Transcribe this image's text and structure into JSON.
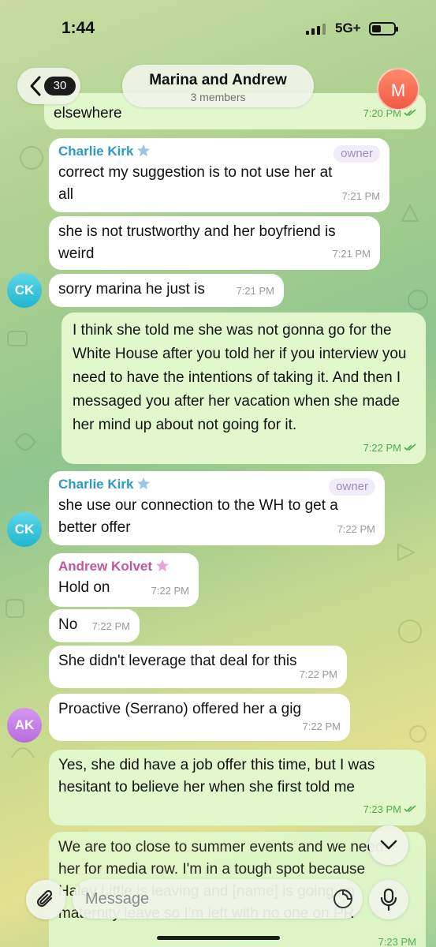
{
  "status_bar": {
    "time": "1:44",
    "network": "5G+"
  },
  "header": {
    "unread_count": "30",
    "title": "Marina and Andrew",
    "subtitle": "3 members",
    "avatar_initial": "M"
  },
  "messages": [
    {
      "id": "m0",
      "direction": "outgoing",
      "text": "elsewhere",
      "time": "7:20 PM"
    },
    {
      "id": "m1",
      "direction": "incoming",
      "sender": "Charlie Kirk",
      "badge": "owner",
      "text": "correct my suggestion is to not use her at all",
      "time": "7:21 PM"
    },
    {
      "id": "m2",
      "direction": "incoming",
      "text": "she is not trustworthy and her boyfriend is weird",
      "time": "7:21 PM"
    },
    {
      "id": "m3",
      "direction": "incoming",
      "text": "sorry marina he just is",
      "time": "7:21 PM",
      "avatar": "CK"
    },
    {
      "id": "m4",
      "direction": "outgoing",
      "text": "I think she told me she was not gonna go for the White House after you told her if you interview you need to have the intentions of taking it. And then I messaged you after her vacation when she made her mind up about not going for it.",
      "time": "7:22 PM"
    },
    {
      "id": "m5",
      "direction": "incoming",
      "sender": "Charlie Kirk",
      "badge": "owner",
      "text": "she use our connection to the WH to get a better offer",
      "time": "7:22 PM",
      "avatar": "CK"
    },
    {
      "id": "m6",
      "direction": "incoming",
      "sender": "Andrew Kolvet",
      "text": "Hold on",
      "time": "7:22 PM"
    },
    {
      "id": "m7",
      "direction": "incoming",
      "text": "No",
      "time": "7:22 PM"
    },
    {
      "id": "m8",
      "direction": "incoming",
      "text": "She didn't leverage that deal for this",
      "time": "7:22 PM"
    },
    {
      "id": "m9",
      "direction": "incoming",
      "text": "Proactive (Serrano) offered her a gig",
      "time": "7:22 PM",
      "avatar": "AK"
    },
    {
      "id": "m10",
      "direction": "outgoing",
      "text": "Yes, she did have a job offer this time, but I was hesitant to believe her when she first told me",
      "time": "7:23 PM"
    },
    {
      "id": "m11",
      "direction": "outgoing",
      "text": "We are too close to summer events and we need her for media row. I'm in a tough spot because Haley Little is leaving and [name] is going on maternity leave so I'm left with no one on PR",
      "time": "7:23 PM"
    }
  ],
  "composer": {
    "placeholder": "Message"
  },
  "colors": {
    "incoming_bubble": "#ffffff",
    "outgoing_bubble": "#e2f8cc",
    "charlie_name": "#2a9bc9",
    "andrew_name": "#c0569e",
    "owner_badge": "#9a8fc2"
  }
}
